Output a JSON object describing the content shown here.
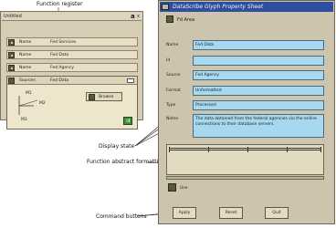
{
  "callouts": {
    "function_register": "Function register",
    "display_state": "Display state",
    "function_abstract_formatting": "Function abstract formatting",
    "command_buttons": "Command buttons"
  },
  "function_register": {
    "title": "Untitled",
    "title_icon": "a",
    "close_icon": "x",
    "rows": [
      {
        "label": "Name",
        "value": "Fed Services"
      },
      {
        "label": "Name",
        "value": "Fed Data"
      },
      {
        "label": "Name",
        "value": "Fed Agency"
      }
    ],
    "box": {
      "label": "Sources",
      "value": "Fed Data",
      "diagram_labels": {
        "top": "M1",
        "right": "M2",
        "bottom": "M3"
      },
      "inner_button_label": "Browse",
      "ok_glyph": "⇉"
    }
  },
  "property_sheet": {
    "title": "DataScribe Glyph Property Sheet",
    "type_label": "Fd Area",
    "fields": [
      {
        "label": "Name",
        "value": "Fed Data"
      },
      {
        "label": "Id",
        "value": ""
      },
      {
        "label": "Source",
        "value": "Fed Agency"
      },
      {
        "label": "Format",
        "value": "Unformatted"
      },
      {
        "label": "Type",
        "value": "Processed"
      }
    ],
    "notes_label": "Notes",
    "notes_value": "The data obtained from the federal agencies via the online connections to their database servers.",
    "bottom_label": "Use",
    "commands": [
      "Apply",
      "Reset",
      "Quit"
    ]
  }
}
